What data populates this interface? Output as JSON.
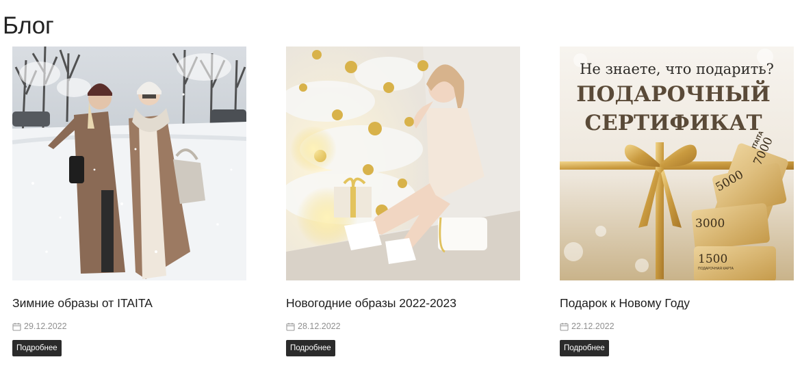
{
  "page": {
    "title": "Блог"
  },
  "posts": [
    {
      "title": "Зимние образы от ITAITA",
      "date": "29.12.2022",
      "button": "Подробнее",
      "image": "winter-street-photo"
    },
    {
      "title": "Новогодние образы 2022-2023",
      "date": "28.12.2022",
      "button": "Подробнее",
      "image": "new-year-tree-photo"
    },
    {
      "title": "Подарок к Новому Году",
      "date": "22.12.2022",
      "button": "Подробнее",
      "image": "gift-certificate-banner"
    }
  ],
  "certificate_banner": {
    "headline": "Не знаете, что подарить?",
    "line1": "ПОДАРОЧНЫЙ",
    "line2": "СЕРТИФИКАТ",
    "cards": [
      "7000",
      "5000",
      "3000",
      "1500"
    ],
    "card_caption": "ПОДАРОЧНАЯ КАРТА",
    "brand": "ITAITA"
  },
  "colors": {
    "button_bg": "#2b2b2b",
    "date_text": "#8f8f8f",
    "gold": "#c9a14a"
  }
}
